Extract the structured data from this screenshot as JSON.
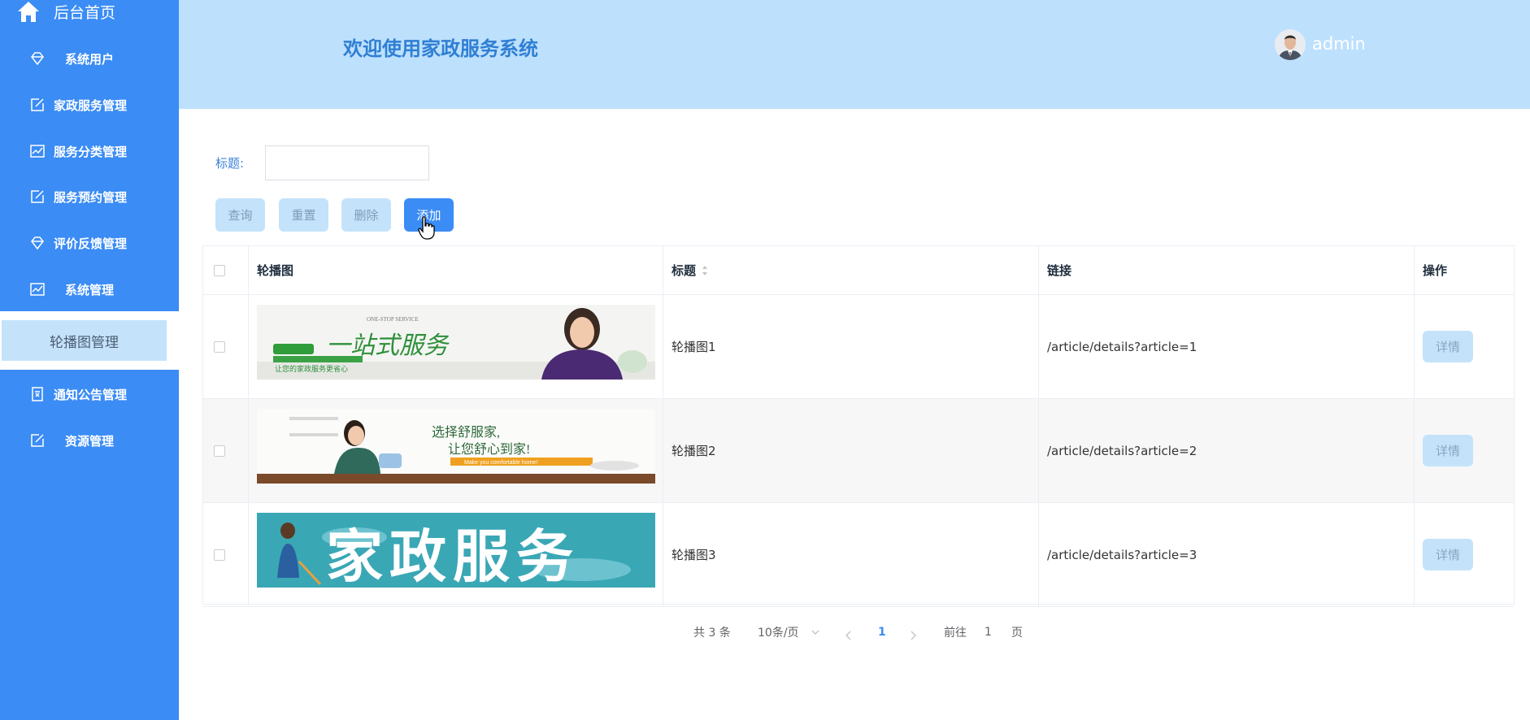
{
  "sidebar": {
    "home_label": "后台首页",
    "items": [
      {
        "label": "系统用户",
        "icon": "diamond-icon"
      },
      {
        "label": "家政服务管理",
        "icon": "edit-icon"
      },
      {
        "label": "服务分类管理",
        "icon": "chart-icon"
      },
      {
        "label": "服务预约管理",
        "icon": "edit-icon"
      },
      {
        "label": "评价反馈管理",
        "icon": "diamond-icon"
      },
      {
        "label": "系统管理",
        "icon": "chart-icon"
      },
      {
        "label": "通知公告管理",
        "icon": "notice-icon"
      },
      {
        "label": "资源管理",
        "icon": "edit-icon"
      }
    ],
    "active_sub_item": "轮播图管理"
  },
  "header": {
    "title": "欢迎使用家政服务系统",
    "username": "admin"
  },
  "search": {
    "label": "标题:",
    "value": "",
    "placeholder": ""
  },
  "toolbar": {
    "query_label": "查询",
    "reset_label": "重置",
    "delete_label": "删除",
    "add_label": "添加"
  },
  "table": {
    "columns": [
      "轮播图",
      "标题",
      "链接",
      "操作"
    ],
    "rows": [
      {
        "title": "轮播图1",
        "link": "/article/details?article=1",
        "action": "详情",
        "banner_text": [
          "ONE-STOP SERVICE",
          "一站式服务",
          "让您的家政服务更省心"
        ]
      },
      {
        "title": "轮播图2",
        "link": "/article/details?article=2",
        "action": "详情",
        "banner_text": [
          "选择舒服家,",
          "让您舒心到家!",
          "Make you comfortable home!"
        ]
      },
      {
        "title": "轮播图3",
        "link": "/article/details?article=3",
        "action": "详情",
        "banner_text": [
          "家政服务"
        ]
      }
    ]
  },
  "pagination": {
    "total": "共 3 条",
    "page_size": "10条/页",
    "current_page": "1",
    "goto_label": "前往",
    "goto_value": "1",
    "page_suffix": "页"
  },
  "colors": {
    "sidebar": "#3b8cf5",
    "header": "#bde0fd",
    "accent": "#3b8cf5",
    "light_button": "#c4e3fb"
  }
}
